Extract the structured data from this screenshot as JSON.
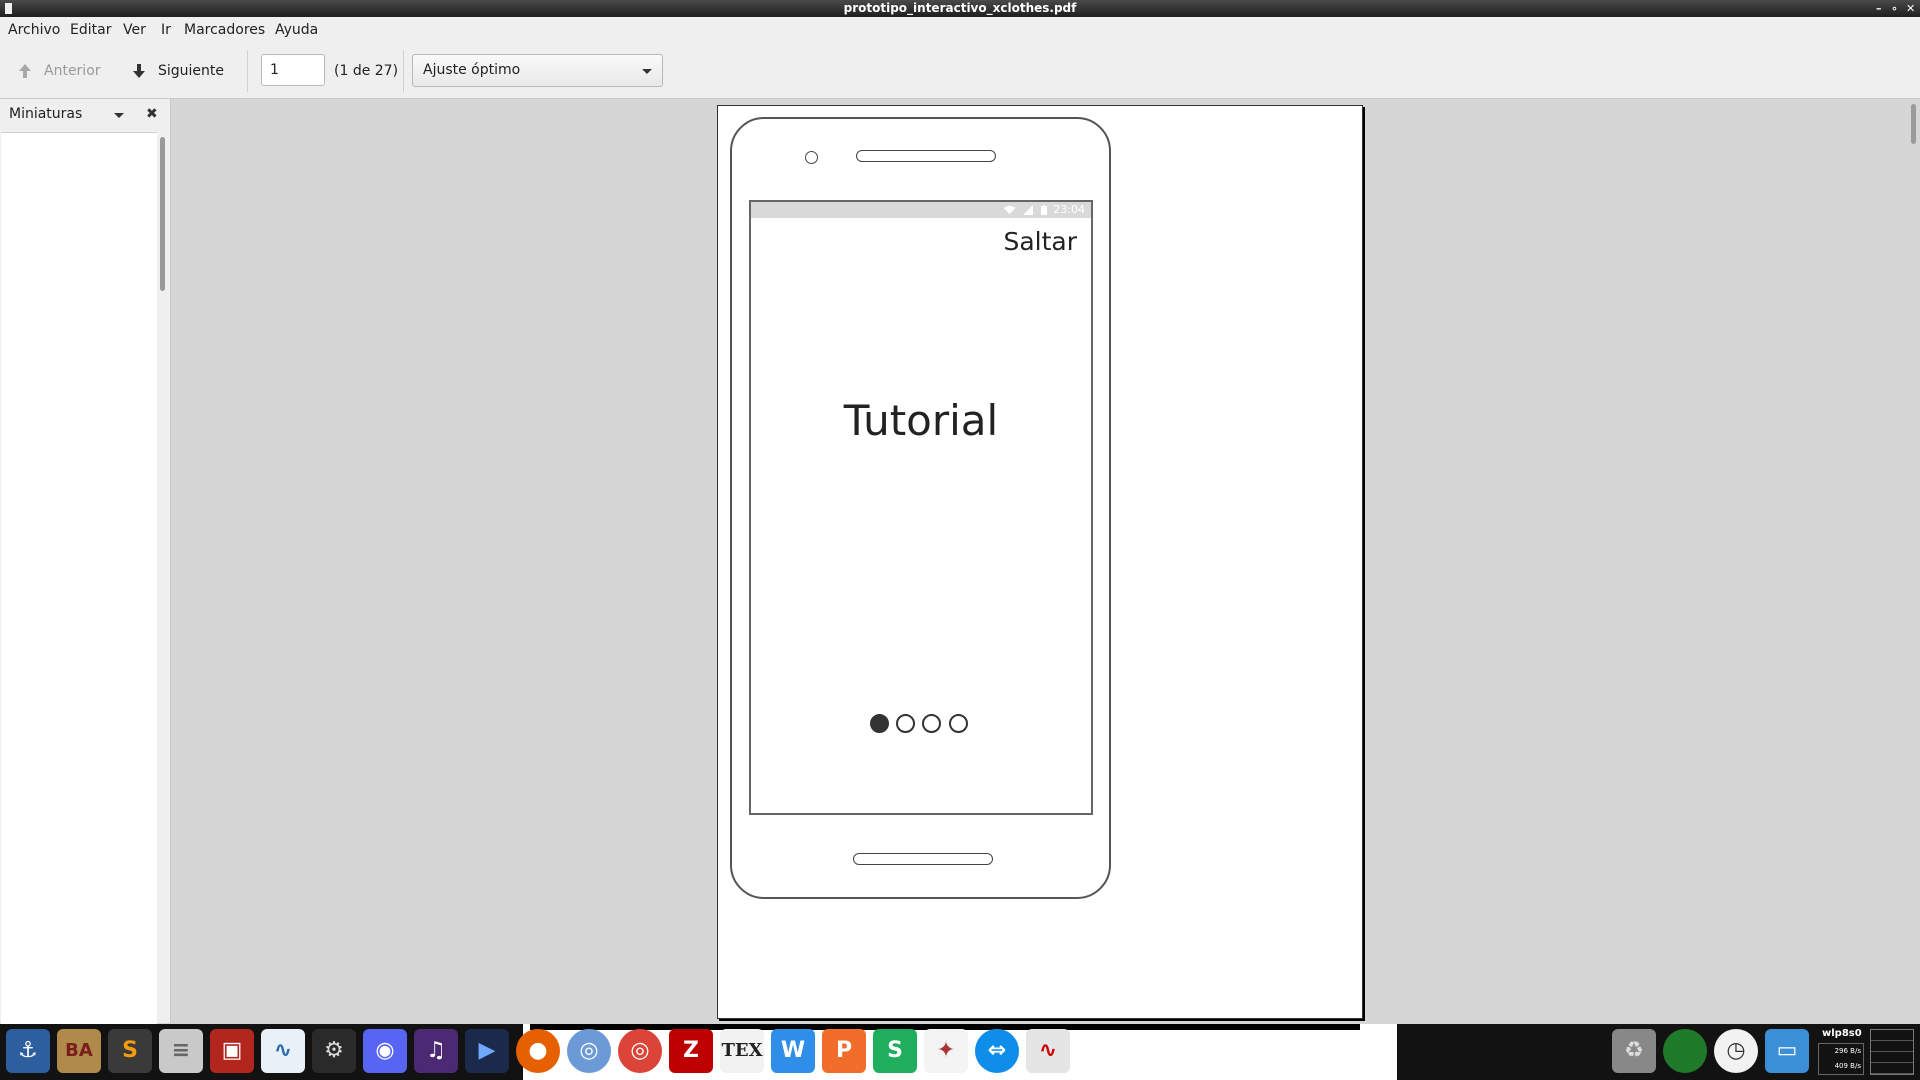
{
  "window": {
    "title": "prototipo_interactivo_xclothes.pdf"
  },
  "menu": {
    "items": [
      "Archivo",
      "Editar",
      "Ver",
      "Ir",
      "Marcadores",
      "Ayuda"
    ]
  },
  "toolbar": {
    "prev_label": "Anterior",
    "next_label": "Siguiente",
    "page_value": "1",
    "page_count": "(1 de 27)",
    "zoom_value": "Ajuste óptimo"
  },
  "sidebar": {
    "title": "Miniaturas"
  },
  "mockup": {
    "status_time": "23:04",
    "skip_label": "Saltar",
    "title": "Tutorial",
    "pager": {
      "total": 4,
      "active": 1
    }
  },
  "taskbar": {
    "network_label": "wlp8s0",
    "down_rate": "296 B/s",
    "up_rate": "409 B/s",
    "icons": [
      "anchor-icon",
      "ba-icon",
      "sublime-icon",
      "files-icon",
      "red-app-icon",
      "monitor-icon",
      "steam-icon",
      "discord-icon",
      "audio-icon",
      "arrow-app-icon",
      "firefox-icon",
      "chromium-icon",
      "chrome-icon",
      "filezilla-icon",
      "tex-icon",
      "writer-icon",
      "presentation-icon",
      "spreadsheet-icon",
      "molecule-icon",
      "teamviewer-icon",
      "pdf-viewer-icon",
      "trash-icon",
      "green-orb-icon",
      "clock-icon",
      "desktop-icon"
    ]
  },
  "colors": {
    "chrome_bg": "#efefef",
    "viewer_bg": "#d6d6d6",
    "titlebar": "#2a2a2a",
    "taskbar": "#121212"
  }
}
